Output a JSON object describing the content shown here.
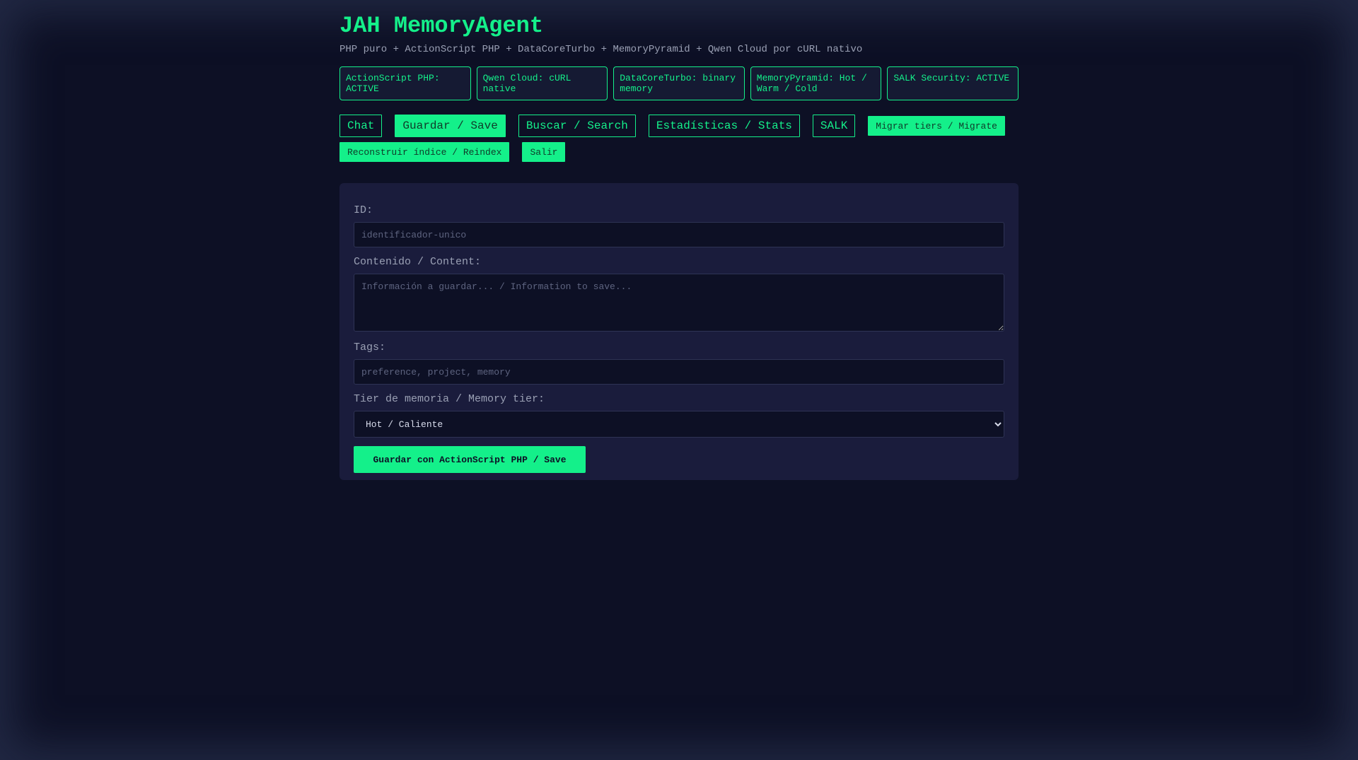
{
  "header": {
    "title": "JAH MemoryAgent",
    "subtitle": "PHP puro + ActionScript PHP + DataCoreTurbo + MemoryPyramid + Qwen Cloud por cURL nativo"
  },
  "status_cards": [
    "ActionScript PHP: ACTIVE",
    "Qwen Cloud: cURL native",
    "DataCoreTurbo: binary memory",
    "MemoryPyramid: Hot / Warm / Cold",
    "SALK Security: ACTIVE"
  ],
  "nav": {
    "chat": "Chat",
    "save": "Guardar / Save",
    "search": "Buscar / Search",
    "stats": "Estadísticas / Stats",
    "salk": "SALK",
    "migrate": "Migrar tiers / Migrate",
    "reindex": "Reconstruir índice / Reindex",
    "logout": "Salir"
  },
  "form": {
    "id_label": "ID:",
    "id_placeholder": "identificador-unico",
    "content_label": "Contenido / Content:",
    "content_placeholder": "Información a guardar... / Information to save...",
    "tags_label": "Tags:",
    "tags_placeholder": "preference, project, memory",
    "tier_label": "Tier de memoria / Memory tier:",
    "tier_selected": "Hot / Caliente",
    "submit_label": "Guardar con ActionScript PHP / Save"
  },
  "colors": {
    "accent": "#14f08a",
    "background": "#0d1025",
    "panel": "#1a1c3c"
  }
}
